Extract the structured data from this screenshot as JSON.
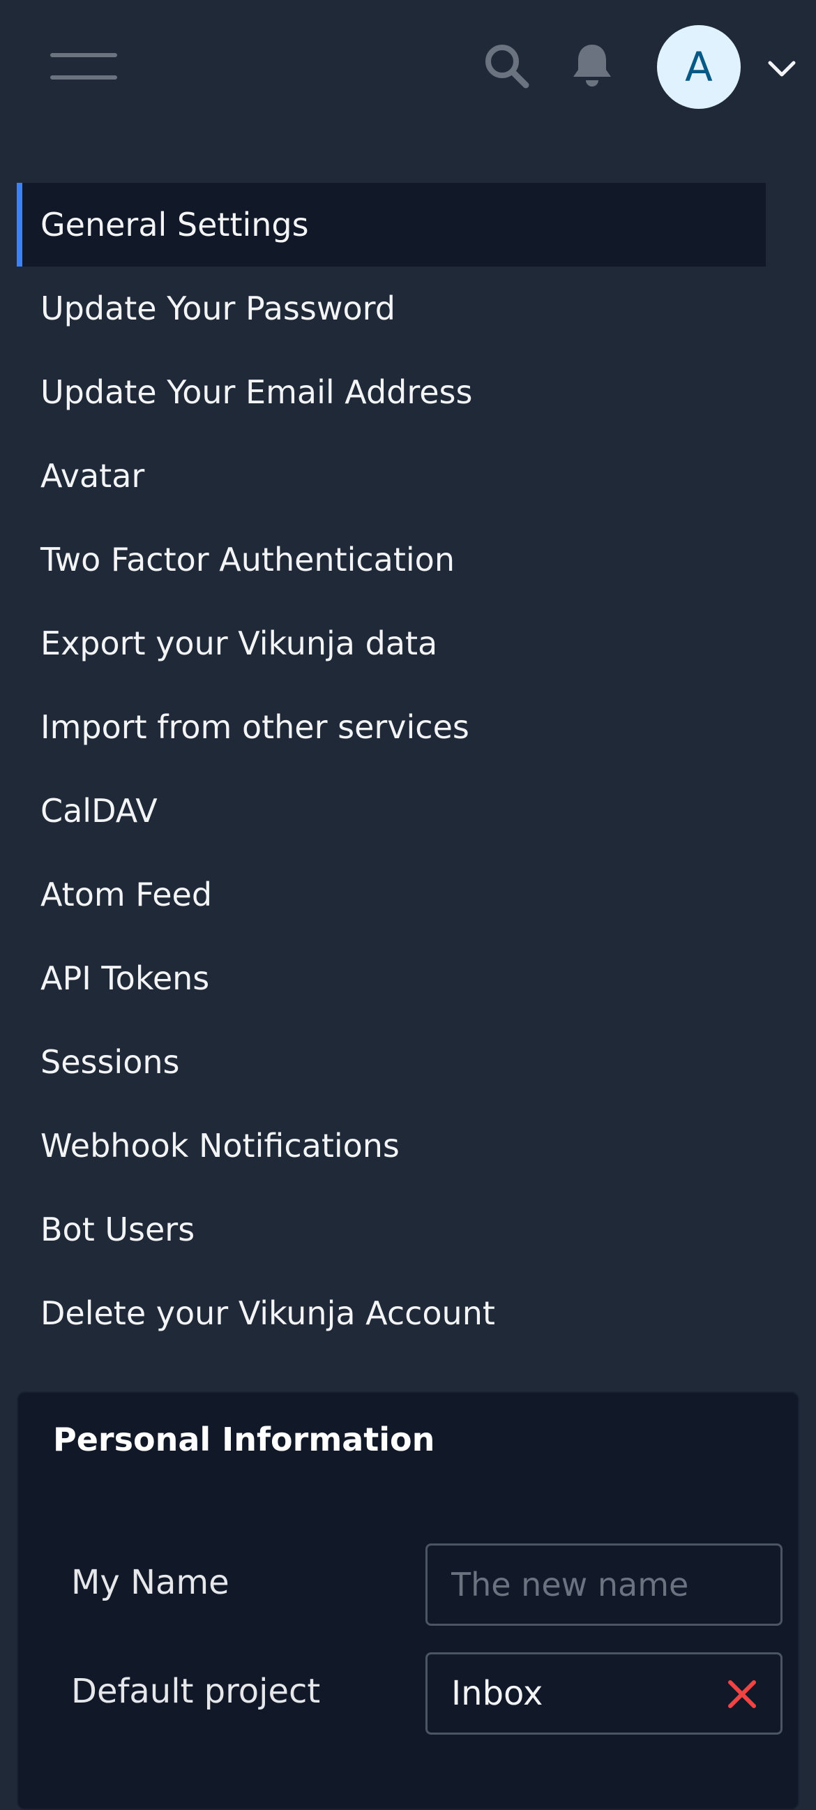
{
  "header": {
    "menu_icon": "hamburger-menu-icon",
    "search_icon": "search-icon",
    "notifications_icon": "bell-icon",
    "avatar_letter": "A",
    "dropdown_icon": "chevron-down-icon"
  },
  "nav": {
    "active_index": 0,
    "items": [
      {
        "label": "General Settings"
      },
      {
        "label": "Update Your Password"
      },
      {
        "label": "Update Your Email Address"
      },
      {
        "label": "Avatar"
      },
      {
        "label": "Two Factor Authentication"
      },
      {
        "label": "Export your Vikunja data"
      },
      {
        "label": "Import from other services"
      },
      {
        "label": "CalDAV"
      },
      {
        "label": "Atom Feed"
      },
      {
        "label": "API Tokens"
      },
      {
        "label": "Sessions"
      },
      {
        "label": "Webhook Notifications"
      },
      {
        "label": "Bot Users"
      },
      {
        "label": "Delete your Vikunja Account"
      }
    ]
  },
  "personal_info": {
    "title": "Personal Information",
    "name_label": "My Name",
    "name_value": "",
    "name_placeholder": "The new name",
    "default_project_label": "Default project",
    "default_project_value": "Inbox",
    "clear_icon": "close-icon"
  },
  "colors": {
    "background": "#1f2937",
    "card": "#111827",
    "accent": "#3b82f6",
    "clear": "#ef4444",
    "avatar_bg": "#e0f2fe"
  }
}
